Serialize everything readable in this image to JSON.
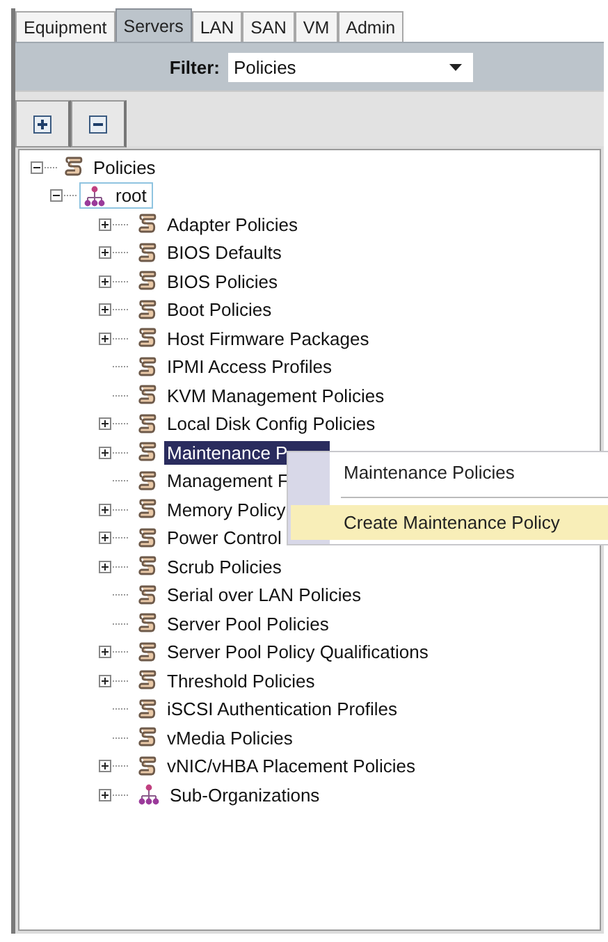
{
  "tabs": [
    {
      "label": "Equipment",
      "selected": false
    },
    {
      "label": "Servers",
      "selected": true
    },
    {
      "label": "LAN",
      "selected": false
    },
    {
      "label": "SAN",
      "selected": false
    },
    {
      "label": "VM",
      "selected": false
    },
    {
      "label": "Admin",
      "selected": false
    }
  ],
  "filter": {
    "label": "Filter:",
    "value": "Policies"
  },
  "tree": [
    {
      "label": "Policies",
      "kind": "policy",
      "expanded": true,
      "selected": false,
      "focused": false,
      "children": [
        {
          "label": "root",
          "kind": "org",
          "expanded": true,
          "selected": false,
          "focused": true,
          "children": [
            {
              "label": "Adapter Policies",
              "kind": "policy",
              "expanded": false,
              "selected": false,
              "focused": false
            },
            {
              "label": "BIOS Defaults",
              "kind": "policy",
              "expanded": false,
              "selected": false,
              "focused": false
            },
            {
              "label": "BIOS Policies",
              "kind": "policy",
              "expanded": false,
              "selected": false,
              "focused": false
            },
            {
              "label": "Boot Policies",
              "kind": "policy",
              "expanded": false,
              "selected": false,
              "focused": false
            },
            {
              "label": "Host Firmware Packages",
              "kind": "policy",
              "expanded": false,
              "selected": false,
              "focused": false
            },
            {
              "label": "IPMI Access Profiles",
              "kind": "policy",
              "selected": false,
              "focused": false
            },
            {
              "label": "KVM Management Policies",
              "kind": "policy",
              "selected": false,
              "focused": false
            },
            {
              "label": "Local Disk Config Policies",
              "kind": "policy",
              "expanded": false,
              "selected": false,
              "focused": false
            },
            {
              "label": "Maintenance P",
              "kind": "policy",
              "expanded": false,
              "selected": true,
              "focused": false
            },
            {
              "label": "Management F",
              "kind": "policy",
              "selected": false,
              "focused": false
            },
            {
              "label": "Memory Policy",
              "kind": "policy",
              "expanded": false,
              "selected": false,
              "focused": false
            },
            {
              "label": "Power Control",
              "kind": "policy",
              "expanded": false,
              "selected": false,
              "focused": false
            },
            {
              "label": "Scrub Policies",
              "kind": "policy",
              "expanded": false,
              "selected": false,
              "focused": false
            },
            {
              "label": "Serial over LAN Policies",
              "kind": "policy",
              "selected": false,
              "focused": false
            },
            {
              "label": "Server Pool Policies",
              "kind": "policy",
              "selected": false,
              "focused": false
            },
            {
              "label": "Server Pool Policy Qualifications",
              "kind": "policy",
              "expanded": false,
              "selected": false,
              "focused": false
            },
            {
              "label": "Threshold Policies",
              "kind": "policy",
              "expanded": false,
              "selected": false,
              "focused": false
            },
            {
              "label": "iSCSI Authentication Profiles",
              "kind": "policy",
              "selected": false,
              "focused": false
            },
            {
              "label": "vMedia Policies",
              "kind": "policy",
              "selected": false,
              "focused": false
            },
            {
              "label": "vNIC/vHBA Placement Policies",
              "kind": "policy",
              "expanded": false,
              "selected": false,
              "focused": false
            },
            {
              "label": "Sub-Organizations",
              "kind": "org",
              "expanded": false,
              "selected": false,
              "focused": false
            }
          ]
        }
      ]
    }
  ],
  "context_menu": [
    {
      "label": "Maintenance Policies",
      "selected": false
    },
    {
      "label": "Create Maintenance Policy",
      "selected": true
    }
  ]
}
